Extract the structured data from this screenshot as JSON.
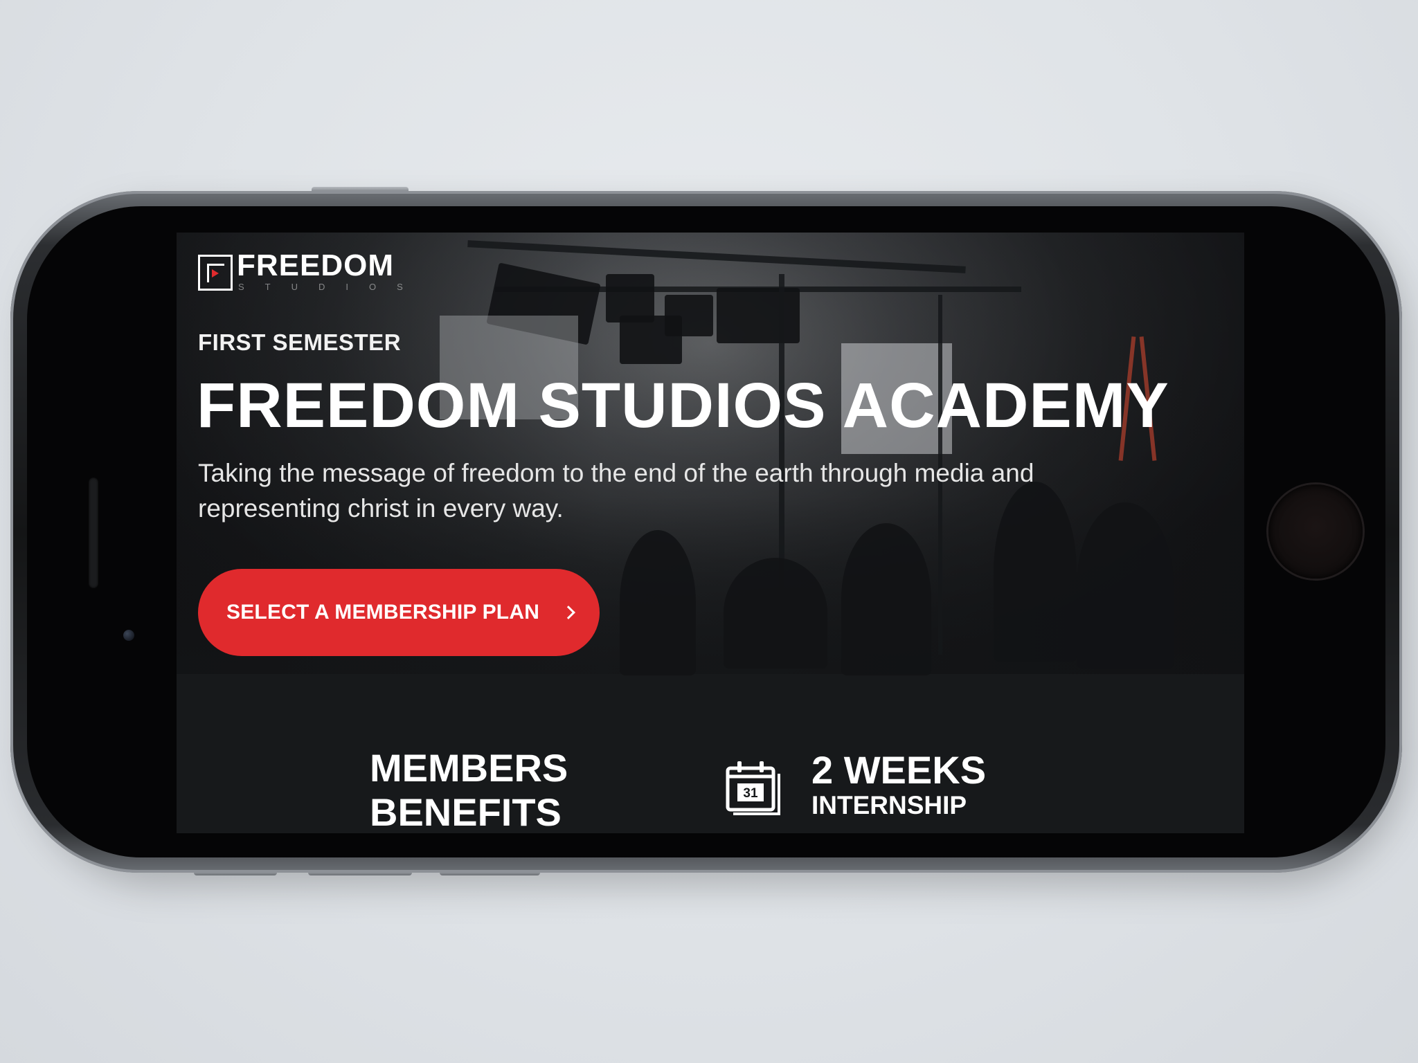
{
  "brand": {
    "logo_word": "FREEDOM",
    "logo_sub": "STUDIOS"
  },
  "hero": {
    "eyebrow": "FIRST SEMESTER",
    "headline": "FREEDOM STUDIOS ACADEMY",
    "tagline": "Taking the message of freedom to the end of the earth through media and representing christ in every way.",
    "cta_label": "SELECT A MEMBERSHIP PLAN"
  },
  "stats": {
    "benefits_line1": "MEMBERS",
    "benefits_line2": "BENEFITS",
    "calendar_day": "31",
    "internship_big": "2 WEEKS",
    "internship_small": "INTERNSHIP"
  },
  "colors": {
    "accent": "#e02a2d",
    "screen_bg": "#17191b",
    "text": "#ffffff"
  },
  "icons": [
    "logo-mark-icon",
    "play-icon",
    "chevron-right-icon",
    "calendar-icon"
  ]
}
